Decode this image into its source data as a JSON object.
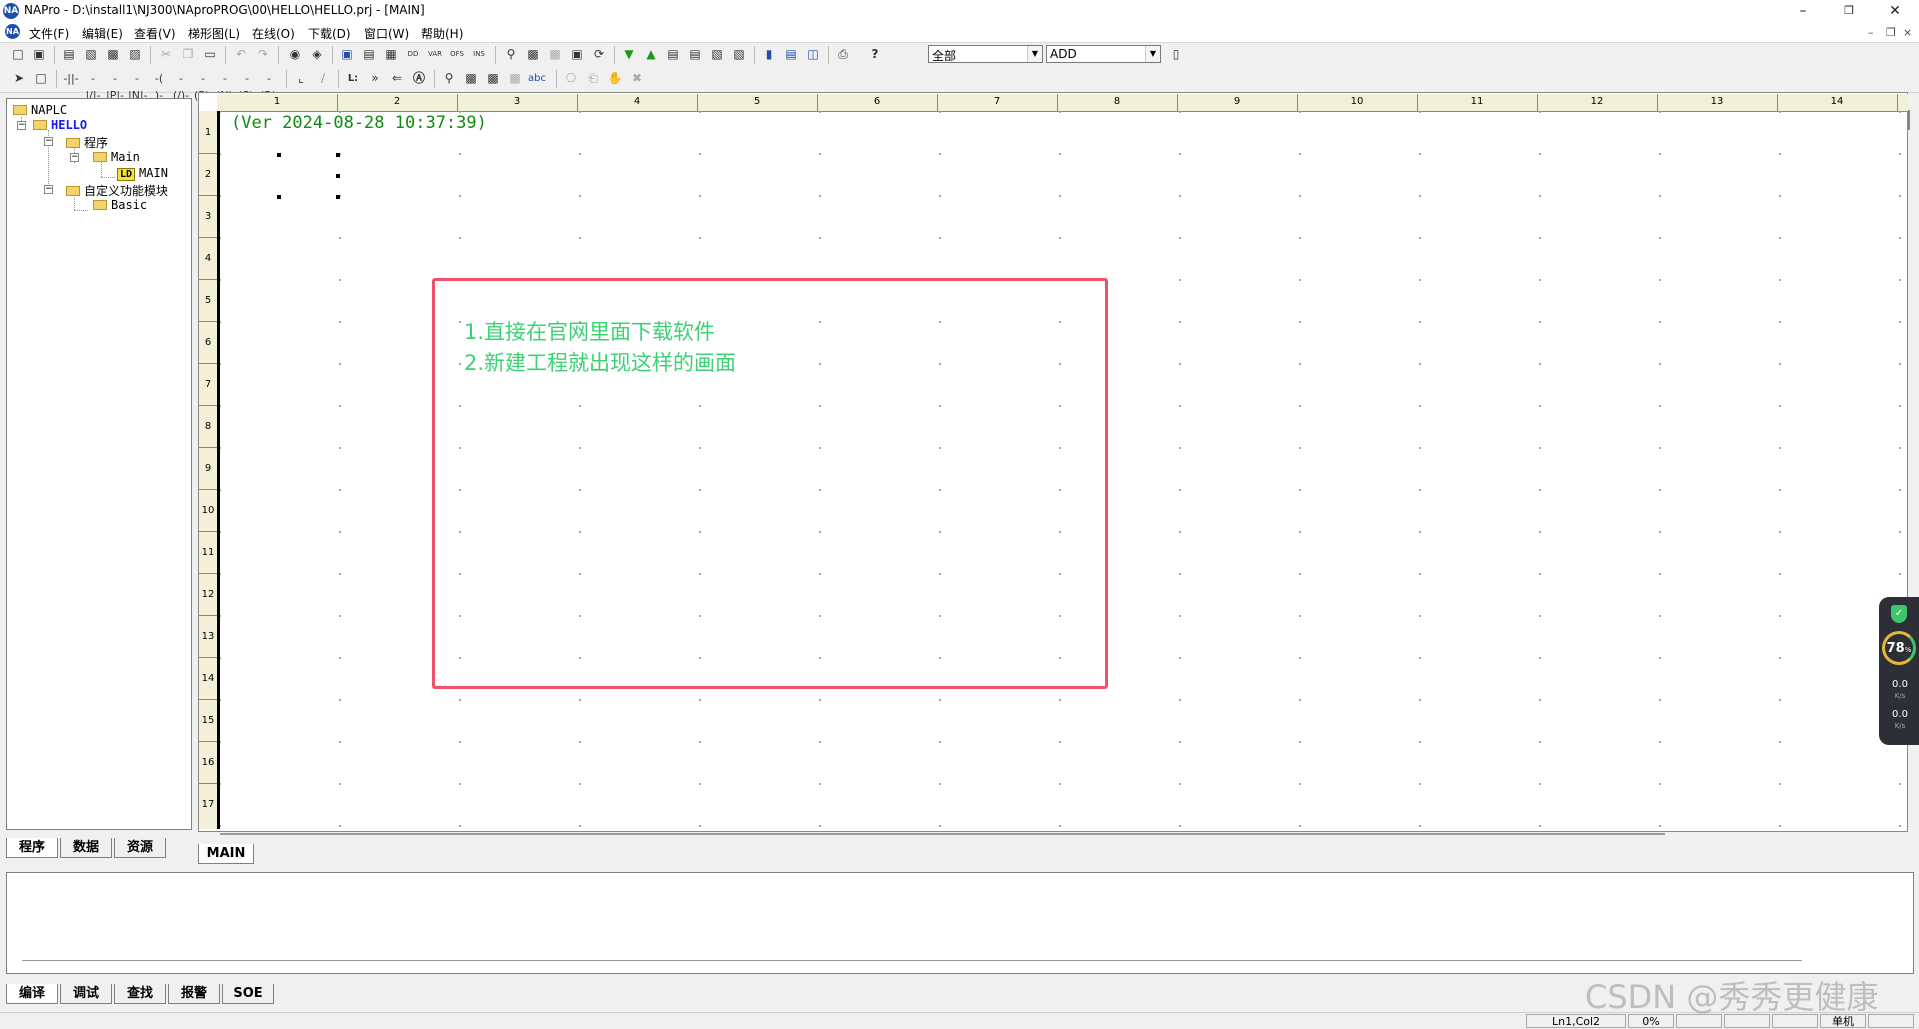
{
  "titlebar": {
    "title": "NAPro - D:\\install1\\NJ300\\NAproPROG\\00\\HELLO\\HELLO.prj - [MAIN]",
    "app_icon": "NA"
  },
  "menubar": {
    "items": [
      "文件(F)",
      "编辑(E)",
      "查看(V)",
      "梯形图(L)",
      "在线(O)",
      "下载(D)",
      "窗口(W)",
      "帮助(H)"
    ]
  },
  "toolbar": {
    "filter_combo": "全部",
    "instr_combo": "ADD",
    "text_tool": "abc"
  },
  "tree": {
    "root": "NAPLC",
    "project": "HELLO",
    "programs": "程序",
    "main_folder": "Main",
    "ld_badge": "LD",
    "main_program": "MAIN",
    "udfb": "自定义功能模块",
    "basic": "Basic"
  },
  "left_tabs": [
    "程序",
    "数据",
    "资源"
  ],
  "editor": {
    "columns": [
      "1",
      "2",
      "3",
      "4",
      "5",
      "6",
      "7",
      "8",
      "9",
      "10",
      "11",
      "12",
      "13",
      "14"
    ],
    "rows": [
      "1",
      "2",
      "3",
      "4",
      "5",
      "6",
      "7",
      "8",
      "9",
      "10",
      "11",
      "12",
      "13",
      "14",
      "15",
      "16",
      "17"
    ],
    "version_text": "(Ver 2024-08-28 10:37:39)",
    "annotation": [
      "1.直接在官网里面下载软件",
      "2.新建工程就出现这样的画面"
    ]
  },
  "sheet_tab": "MAIN",
  "output_tabs": [
    "编译",
    "调试",
    "查找",
    "报警",
    "SOE"
  ],
  "statusbar": {
    "position": "Ln1,Col2",
    "percent": "0%",
    "mode": "单机"
  },
  "widget": {
    "percent": "78",
    "percent_unit": "%",
    "up": "0.0",
    "down": "0.0",
    "unit": "K/s"
  },
  "watermark": "CSDN @秀秀更健康",
  "colors": {
    "version_green": "#118a11",
    "annotation_red": "#f0506a",
    "annotation_text": "#3cd273"
  }
}
